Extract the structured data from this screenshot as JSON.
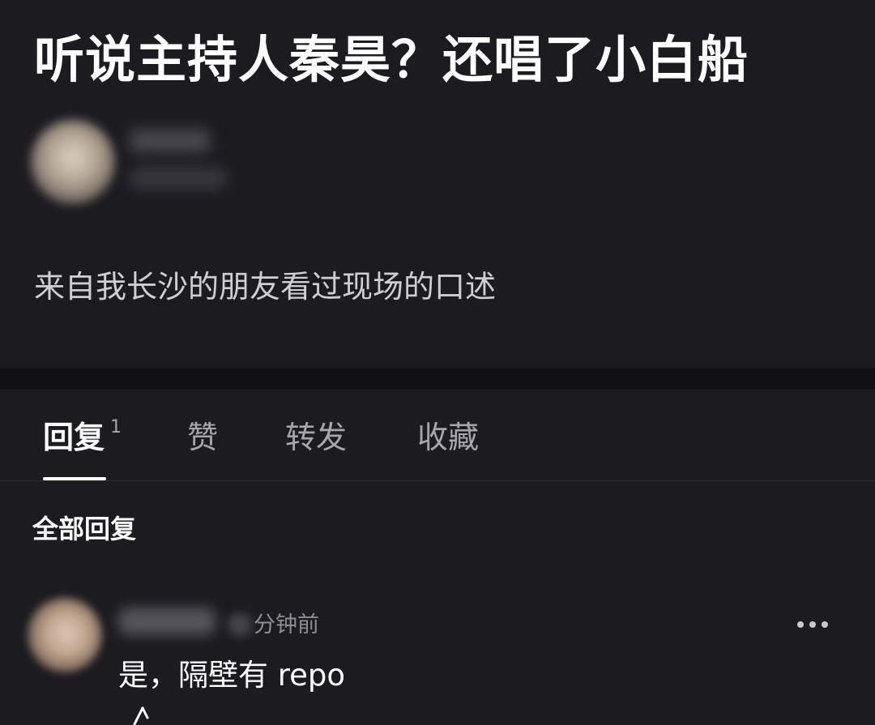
{
  "post": {
    "title": "听说主持人秦昊？还唱了小白船",
    "body": "来自我长沙的朋友看过现场的口述"
  },
  "tabs": [
    {
      "label": "回复",
      "count": "1",
      "active": true
    },
    {
      "label": "赞",
      "active": false
    },
    {
      "label": "转发",
      "active": false
    },
    {
      "label": "收藏",
      "active": false
    }
  ],
  "replies_section": {
    "heading": "全部回复",
    "items": [
      {
        "time_suffix": "分钟前",
        "text": "是，隔壁有 repo",
        "more_icon": "more-horizontal-icon"
      }
    ]
  },
  "colors": {
    "background": "#1c1b20",
    "divider": "#111014",
    "text_primary": "#ffffff",
    "text_secondary": "#a7a6ad"
  }
}
